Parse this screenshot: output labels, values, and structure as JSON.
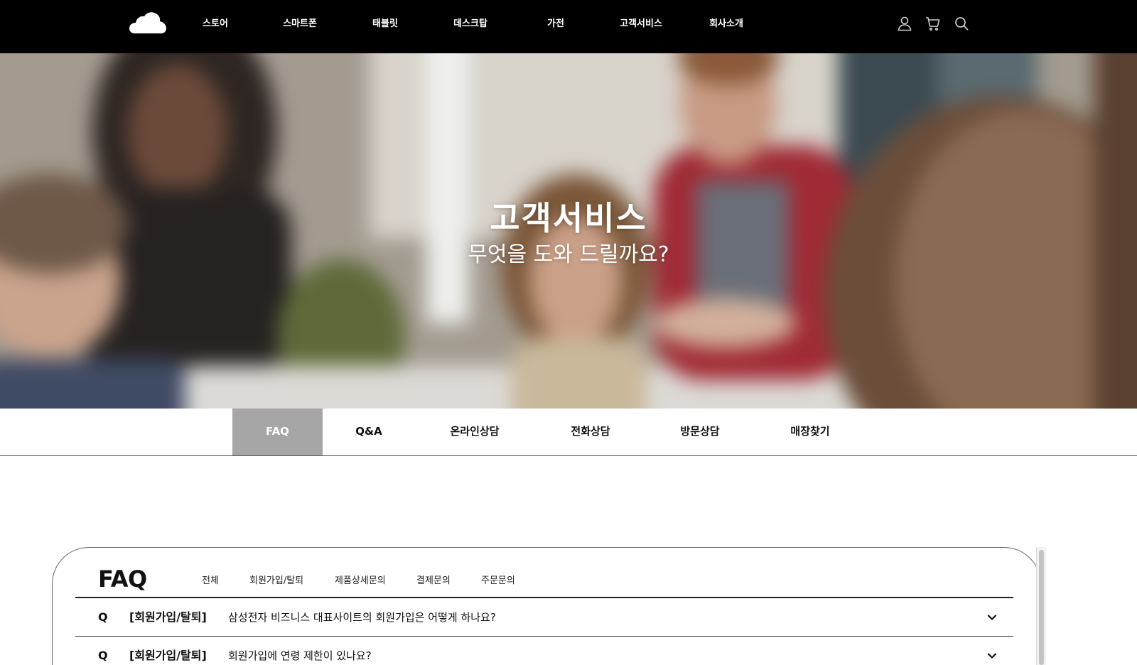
{
  "header": {
    "logo_icon": "cloud-logo-icon",
    "nav": [
      {
        "label": "스토어"
      },
      {
        "label": "스마트폰"
      },
      {
        "label": "태블릿"
      },
      {
        "label": "데스크탑"
      },
      {
        "label": "가전"
      },
      {
        "label": "고객서비스"
      },
      {
        "label": "회사소개"
      }
    ],
    "utility_icons": [
      "user-icon",
      "cart-icon",
      "search-icon"
    ]
  },
  "hero": {
    "title": "고객서비스",
    "subtitle": "무엇을 도와 드릴까요?"
  },
  "service_tabs": [
    {
      "label": "FAQ",
      "active": true
    },
    {
      "label": "Q&A",
      "active": false
    },
    {
      "label": "온라인상담",
      "active": false
    },
    {
      "label": "전화상담",
      "active": false
    },
    {
      "label": "방문상담",
      "active": false
    },
    {
      "label": "매장찾기",
      "active": false
    }
  ],
  "faq": {
    "heading": "FAQ",
    "filters": [
      "전체",
      "회원가입/탈퇴",
      "제품상세문의",
      "결제문의",
      "주문문의"
    ],
    "items": [
      {
        "q": "Q",
        "category": "[회원가입/탈퇴]",
        "question": "삼성전자 비즈니스 대표사이트의 회원가입은 어떻게 하나요?"
      },
      {
        "q": "Q",
        "category": "[회원가입/탈퇴]",
        "question": "회원가입에 연령 제한이 있나요?"
      }
    ]
  },
  "colors": {
    "topbar_bg": "#000000",
    "active_tab_bg": "#a6a6a6",
    "text": "#111111"
  }
}
